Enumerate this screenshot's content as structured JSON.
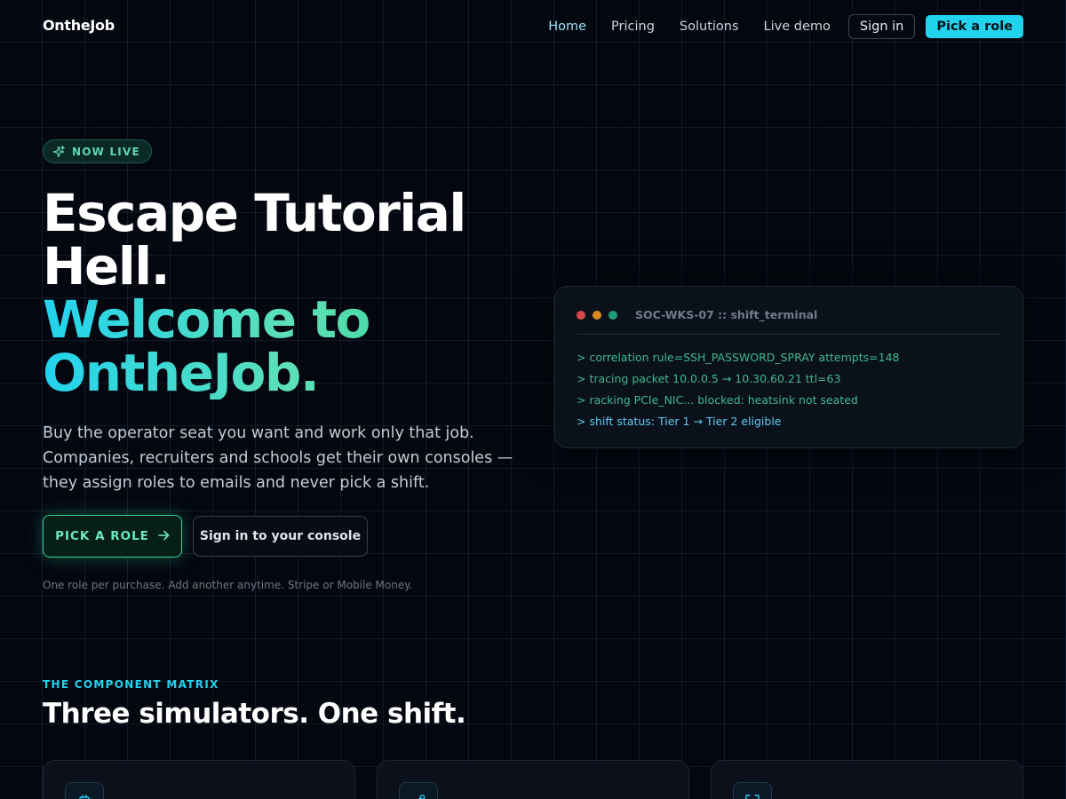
{
  "nav": {
    "logo": "OntheJob",
    "links": [
      "Home",
      "Pricing",
      "Solutions",
      "Live demo"
    ],
    "signin": "Sign in",
    "cta": "Pick a role"
  },
  "badge": {
    "icon": "sparkles-icon",
    "text": "NOW LIVE"
  },
  "hero": {
    "title_lines": [
      "Escape Tutorial",
      "Hell."
    ],
    "title_gradient_lines": [
      "Welcome to",
      "OntheJob."
    ],
    "subtitle": "Buy the operator seat you want and work only that job. Companies, recruiters and schools get their own consoles — they assign roles to emails and never pick a shift.",
    "primary_button": "PICK A ROLE",
    "primary_button_icon": "arrow-right-icon",
    "secondary_button": "Sign in to your console",
    "note": "One role per purchase. Add another anytime. Stripe or Mobile Money."
  },
  "terminal": {
    "title": "SOC-WKS-07 :: shift_terminal",
    "dots": [
      "#d94848",
      "#d98a1f",
      "#1f9c78"
    ],
    "lines": [
      "> correlation rule=SSH_PASSWORD_SPRAY attempts=148",
      "> tracing packet 10.0.0.5 → 10.30.60.21 ttl=63",
      "> racking PCIe_NIC... blocked: heatsink not seated",
      "> shift status: Tier 1 → Tier 2 eligible"
    ]
  },
  "section": {
    "eyebrow": "THE COMPONENT MATRIX",
    "title": "Three simulators. One shift.",
    "card_icons": [
      "chip-icon",
      "network-nodes-icon",
      "scan-frame-icon"
    ]
  },
  "colors": {
    "background": "#04070f",
    "accent_cyan": "#22d3ee",
    "accent_green": "#34d399"
  }
}
